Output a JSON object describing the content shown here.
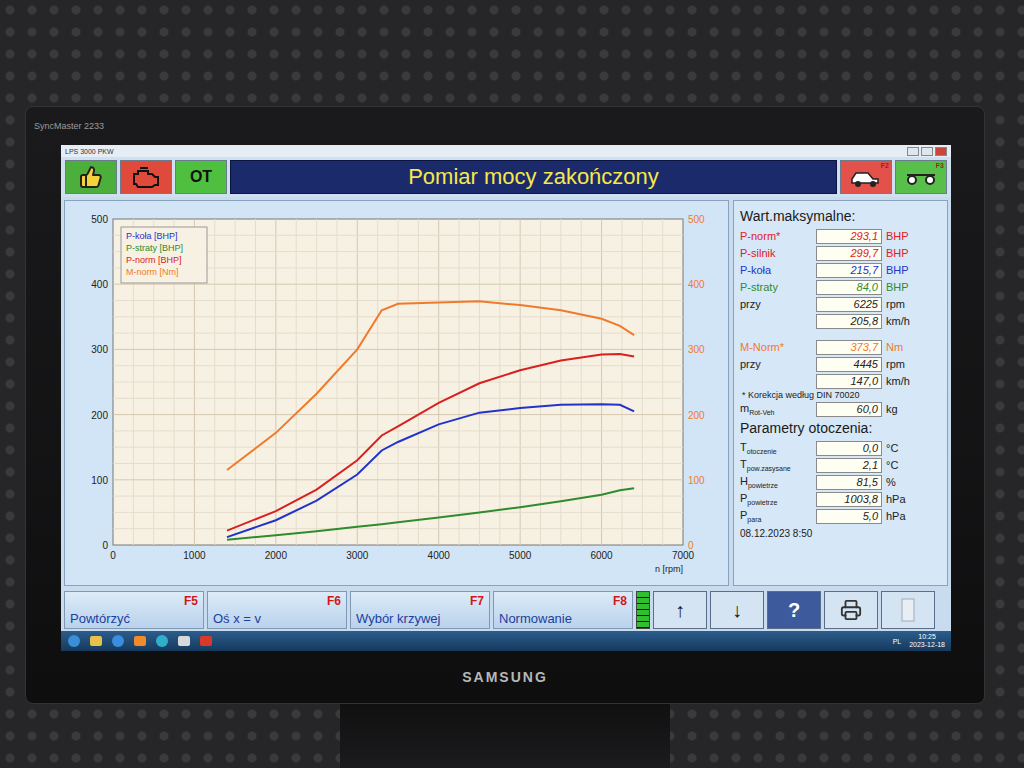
{
  "monitor": {
    "model": "SyncMaster 2233",
    "brand": "SAMSUNG"
  },
  "window": {
    "title": "LPS 3000 PKW"
  },
  "toolbar": {
    "ot": "OT",
    "title": "Pomiar mocy zakończony",
    "f2": "F2",
    "f3": "F3"
  },
  "chart": {
    "x_ticks": [
      "0",
      "1000",
      "2000",
      "3000",
      "4000",
      "5000",
      "6000",
      "7000"
    ],
    "y_ticks": [
      "0",
      "100",
      "200",
      "300",
      "400",
      "500"
    ],
    "y2_ticks": [
      "0",
      "100",
      "200",
      "300",
      "400",
      "500"
    ],
    "x_label": "n [rpm]",
    "rpm": [
      1400,
      2000,
      2500,
      3000,
      3300,
      3500,
      4000,
      4500,
      5000,
      5500,
      6000,
      6225,
      6400
    ],
    "series": [
      {
        "name": "P-koła [BHP]",
        "color": "#2233cc",
        "axis": "left",
        "values": [
          12,
          38,
          68,
          108,
          145,
          158,
          185,
          203,
          210,
          215,
          215.7,
          215,
          205
        ]
      },
      {
        "name": "P-straty [BHP]",
        "color": "#2e8b2e",
        "axis": "left",
        "values": [
          8,
          15,
          21,
          28,
          32,
          35,
          42,
          50,
          58,
          67,
          77,
          84,
          87
        ]
      },
      {
        "name": "P-norm [BHP]",
        "color": "#d82020",
        "axis": "left",
        "values": [
          22,
          52,
          85,
          130,
          168,
          182,
          218,
          248,
          268,
          283,
          292,
          293.1,
          289
        ]
      },
      {
        "name": "M-norm [Nm]",
        "color": "#f07a2a",
        "axis": "right",
        "values": [
          115,
          172,
          232,
          300,
          360,
          370,
          372,
          373.7,
          368,
          360,
          347,
          336,
          322
        ]
      }
    ]
  },
  "max_values": {
    "title": "Wart.maksymalne:",
    "groups": [
      [
        {
          "label": "P-norm*",
          "value": "293,1",
          "unit": "BHP",
          "color": "#e02020"
        },
        {
          "label": "P-silnik",
          "value": "299,7",
          "unit": "BHP",
          "color": "#e02020"
        },
        {
          "label": "P-koła",
          "value": "215,7",
          "unit": "BHP",
          "color": "#2233cc"
        },
        {
          "label": "P-straty",
          "value": "84,0",
          "unit": "BHP",
          "color": "#2e8b2e"
        },
        {
          "label": "przy",
          "value": "6225",
          "unit": "rpm",
          "color": "#222222"
        },
        {
          "label": "",
          "value": "205,8",
          "unit": "km/h",
          "color": "#222222"
        }
      ],
      [
        {
          "label": "M-Norm*",
          "value": "373,7",
          "unit": "Nm",
          "color": "#f07a2a"
        },
        {
          "label": "przy",
          "value": "4445",
          "unit": "rpm",
          "color": "#222222"
        },
        {
          "label": "",
          "value": "147,0",
          "unit": "km/h",
          "color": "#222222"
        }
      ]
    ],
    "note": "* Korekcja według DIN 70020",
    "mass": {
      "symbol": "m",
      "sub": "Rot-Veh",
      "value": "60,0",
      "unit": "kg"
    }
  },
  "environment": {
    "title": "Parametry otoczenia:",
    "rows": [
      {
        "symbol": "T",
        "sub": "otoczenie",
        "value": "0,0",
        "unit": "°C"
      },
      {
        "symbol": "T",
        "sub": "pow.zasysane",
        "value": "2,1",
        "unit": "°C"
      },
      {
        "symbol": "H",
        "sub": "powietrze",
        "value": "81,5",
        "unit": "%"
      },
      {
        "symbol": "P",
        "sub": "powietrze",
        "value": "1003,8",
        "unit": "hPa"
      },
      {
        "symbol": "P",
        "sub": "para",
        "value": "5,0",
        "unit": "hPa"
      }
    ],
    "date": "08.12.2023 8:50"
  },
  "buttons": [
    {
      "label": "Powtórzyć",
      "key": "F5"
    },
    {
      "label": "Oś x = v",
      "key": "F6"
    },
    {
      "label": "Wybór krzywej",
      "key": "F7"
    },
    {
      "label": "Normowanie",
      "key": "F8"
    }
  ],
  "indicator": {
    "level": 1
  },
  "nav": [
    "↑",
    "↓",
    "?"
  ],
  "taskbar": {
    "lang": "PL",
    "time": "10:25",
    "date": "2023-12-18"
  }
}
